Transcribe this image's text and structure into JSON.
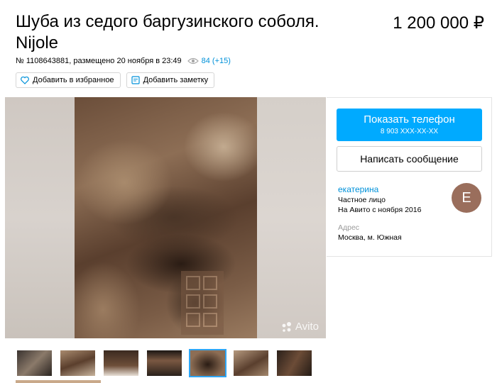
{
  "listing": {
    "title": "Шуба из седого баргузинского соболя. Nijole",
    "price": "1 200 000 ₽",
    "meta": "№ 1108643881, размещено 20 ноября в 23:49",
    "views": "84 (+15)"
  },
  "actions": {
    "favorite_label": "Добавить в избранное",
    "note_label": "Добавить заметку"
  },
  "gallery": {
    "watermark": "Avito",
    "thumbnail_count": 7,
    "active_index": 4
  },
  "contact": {
    "call_label": "Показать телефон",
    "phone_masked": "8 903 XXX-XX-XX",
    "message_label": "Написать сообщение"
  },
  "seller": {
    "name": "екатерина",
    "type": "Частное лицо",
    "since": "На Авито с ноября 2016",
    "avatar_letter": "Е"
  },
  "address": {
    "label": "Адрес",
    "value": "Москва, м. Южная"
  },
  "colors": {
    "accent": "#00aaff",
    "link": "#0091d9",
    "avatar_bg": "#9a6e5c",
    "active_thumb": "#2ea6f5"
  },
  "icons": {
    "views": "eye-icon",
    "favorite": "heart-icon",
    "note": "note-icon",
    "watermark": "avito-logo-icon"
  }
}
